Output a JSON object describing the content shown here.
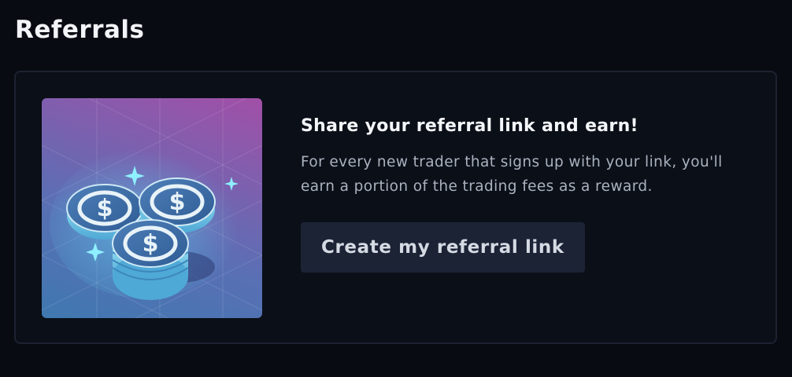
{
  "page": {
    "title": "Referrals"
  },
  "referral_card": {
    "illustration_icon": "stacked-dollar-coins",
    "headline": "Share your referral link and earn!",
    "description": "For every new trader that signs up with your link, you'll earn a portion of the trading fees as a reward.",
    "cta_label": "Create my referral link"
  },
  "colors": {
    "background": "#080b12",
    "card_border": "#1c2230",
    "button_bg": "#1b2335",
    "body_text": "#aab2bf"
  }
}
